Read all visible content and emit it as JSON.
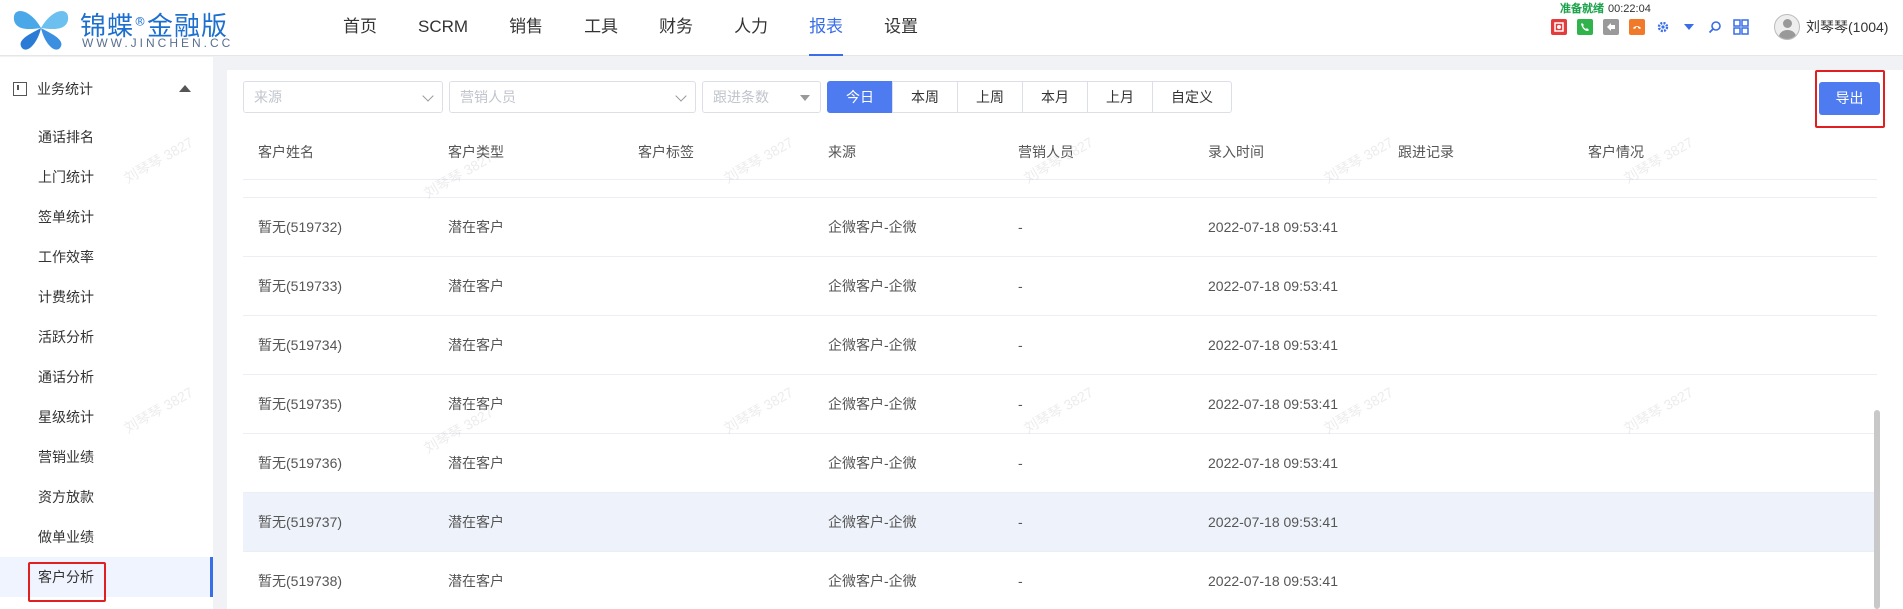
{
  "header": {
    "brand_cn": "锦蝶",
    "brand_mark": "®",
    "brand_suffix": "金融版",
    "brand_domain": "WWW.JINCHEN.CC",
    "nav": [
      "首页",
      "SCRM",
      "销售",
      "工具",
      "财务",
      "人力",
      "报表",
      "设置"
    ],
    "active_nav": "报表",
    "call_status": "准备就绪",
    "call_timer": "00:22:04",
    "user_name": "刘琴琴(1004)",
    "tool_icons": [
      {
        "name": "record-icon",
        "color": "#e43b3b"
      },
      {
        "name": "answer-call-icon",
        "color": "#2fb34a"
      },
      {
        "name": "transfer-call-icon",
        "color": "#9a9a9a"
      },
      {
        "name": "hangup-icon",
        "color": "#f07a2a"
      },
      {
        "name": "gear-icon",
        "color": "#3a6de8"
      },
      {
        "name": "dropdown-icon",
        "color": "#3a6de8"
      },
      {
        "name": "search-icon",
        "color": "#3a6de8"
      },
      {
        "name": "grid-icon",
        "color": "#3a6de8"
      }
    ]
  },
  "sidebar": {
    "group_label": "业务统计",
    "items": [
      "通话排名",
      "上门统计",
      "签单统计",
      "工作效率",
      "计费统计",
      "活跃分析",
      "通话分析",
      "星级统计",
      "营销业绩",
      "资方放款",
      "做单业绩",
      "客户分析"
    ],
    "active_item": "客户分析"
  },
  "filters": {
    "source_placeholder": "来源",
    "sales_placeholder": "营销人员",
    "followup_placeholder": "跟进条数",
    "periods": [
      "今日",
      "本周",
      "上周",
      "本月",
      "上月",
      "自定义"
    ],
    "active_period": "今日",
    "export_label": "导出"
  },
  "table": {
    "columns": [
      "客户姓名",
      "客户类型",
      "客户标签",
      "来源",
      "营销人员",
      "录入时间",
      "跟进记录",
      "客户情况"
    ],
    "rows": [
      [
        "暂无(519732)",
        "潜在客户",
        "",
        "企微客户-企微",
        "-",
        "2022-07-18 09:53:41",
        "",
        ""
      ],
      [
        "暂无(519733)",
        "潜在客户",
        "",
        "企微客户-企微",
        "-",
        "2022-07-18 09:53:41",
        "",
        ""
      ],
      [
        "暂无(519734)",
        "潜在客户",
        "",
        "企微客户-企微",
        "-",
        "2022-07-18 09:53:41",
        "",
        ""
      ],
      [
        "暂无(519735)",
        "潜在客户",
        "",
        "企微客户-企微",
        "-",
        "2022-07-18 09:53:41",
        "",
        ""
      ],
      [
        "暂无(519736)",
        "潜在客户",
        "",
        "企微客户-企微",
        "-",
        "2022-07-18 09:53:41",
        "",
        ""
      ],
      [
        "暂无(519737)",
        "潜在客户",
        "",
        "企微客户-企微",
        "-",
        "2022-07-18 09:53:41",
        "",
        ""
      ],
      [
        "暂无(519738)",
        "潜在客户",
        "",
        "企微客户-企微",
        "-",
        "2022-07-18 09:53:41",
        "",
        ""
      ]
    ],
    "hover_row": 5
  },
  "watermark_text": "刘琴琴 3827",
  "colors": {
    "accent": "#4e7bf0",
    "highlight": "#e02020"
  }
}
